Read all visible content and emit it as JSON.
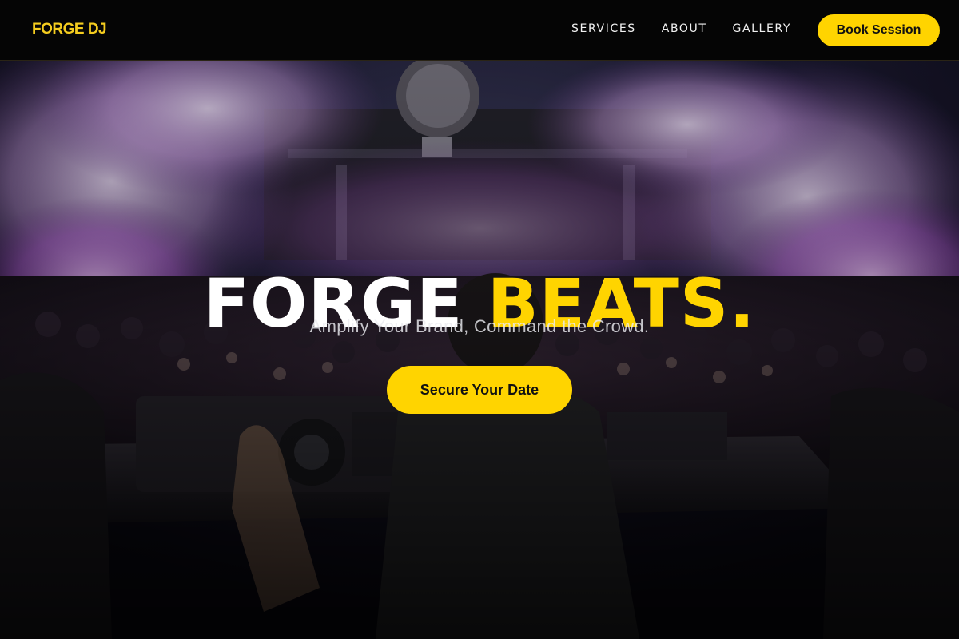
{
  "nav": {
    "logo": "FORGE DJ",
    "links": [
      "SERVICES",
      "ABOUT",
      "GALLERY"
    ],
    "cta_label": "Book Session"
  },
  "hero": {
    "title_part1": "FORGE",
    "title_part2": "BEATS.",
    "subtitle": "Amplify Your Brand, Command the Crowd.",
    "cta_label": "Secure Your Date"
  },
  "colors": {
    "accent": "#FFD400",
    "nav_bg": "#050505",
    "text_light": "#FFFFFF"
  }
}
